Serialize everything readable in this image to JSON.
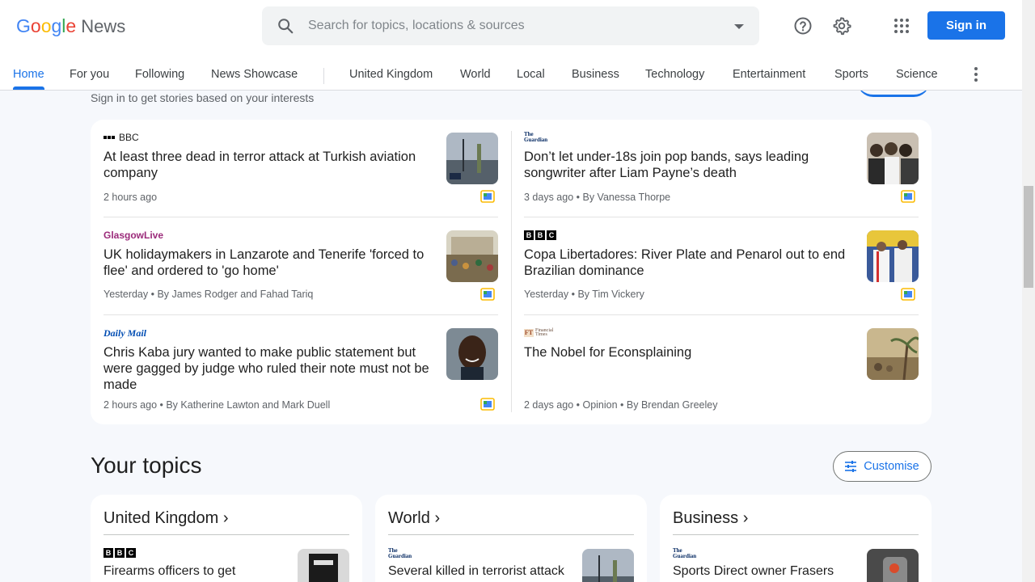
{
  "header": {
    "logo_letters": [
      "G",
      "o",
      "o",
      "g",
      "l",
      "e"
    ],
    "logo_news": "News",
    "search_placeholder": "Search for topics, locations & sources",
    "signin_label": "Sign in",
    "icons": [
      "search-icon",
      "help-icon",
      "gear-icon",
      "apps-grid-icon",
      "more-vert-icon"
    ]
  },
  "nav": {
    "tabs": [
      "Home",
      "For you",
      "Following",
      "News Showcase",
      "United Kingdom",
      "World",
      "Local",
      "Business",
      "Technology",
      "Entertainment",
      "Sports",
      "Science"
    ],
    "active": "Home"
  },
  "signin_prompt": "Sign in to get stories based on your interests",
  "stories": [
    {
      "source": "BBC",
      "headline": "At least three dead in terror attack at Turkish aviation company",
      "meta": "2 hours ago"
    },
    {
      "source": "The Guardian",
      "headline": "Don’t let under-18s join pop bands, says leading songwriter after Liam Payne’s death",
      "meta": "3 days ago • By Vanessa Thorpe"
    },
    {
      "source": "GlasgowLive",
      "headline": "UK holidaymakers in Lanzarote and Tenerife 'forced to flee' and ordered to 'go home'",
      "meta": "Yesterday • By James Rodger and Fahad Tariq"
    },
    {
      "source": "BBC",
      "headline": "Copa Libertadores: River Plate and Penarol out to end Brazilian dominance",
      "meta": "Yesterday • By Tim Vickery"
    },
    {
      "source": "Daily Mail",
      "headline": "Chris Kaba jury wanted to make public statement but were gagged by judge who ruled their note must not be made",
      "meta": "2 hours ago • By Katherine Lawton and Mark Duell"
    },
    {
      "source": "Financial Times",
      "headline": "The Nobel for Econsplaining",
      "meta": "2 days ago • Opinion • By Brendan Greeley"
    }
  ],
  "topics": {
    "title": "Your topics",
    "customise_label": "Customise",
    "cards": [
      {
        "title": "United Kingdom",
        "source": "BBC",
        "headline": "Firearms officers to get"
      },
      {
        "title": "World",
        "source": "The Guardian",
        "headline": "Several killed in terrorist attack"
      },
      {
        "title": "Business",
        "source": "The Guardian",
        "headline": "Sports Direct owner Frasers"
      }
    ]
  },
  "colors": {
    "accent": "#1a73e8",
    "background": "#f6f8fc"
  }
}
